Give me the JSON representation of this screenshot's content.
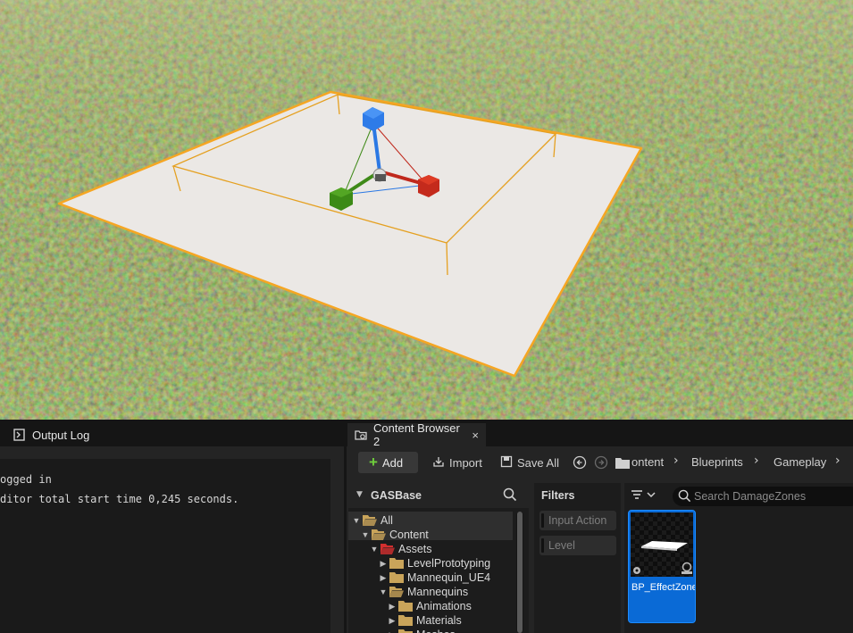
{
  "output_log": {
    "tab_label": "Output Log",
    "lines": [
      "ogged in",
      "ditor total start time 0,245 seconds."
    ]
  },
  "content_browser": {
    "tab_label": "Content Browser 2",
    "close_glyph": "×",
    "toolbar": {
      "add_label": "Add",
      "import_label": "Import",
      "save_all_label": "Save All"
    },
    "breadcrumb": [
      "ontent",
      "Blueprints",
      "Gameplay"
    ],
    "tree": {
      "header": "GASBase",
      "items": [
        {
          "label": "All",
          "arrow": "▼",
          "folder": "open"
        },
        {
          "label": "Content",
          "arrow": "▼",
          "folder": "open"
        },
        {
          "label": "Assets",
          "arrow": "▼",
          "folder": "open-red"
        },
        {
          "label": "LevelPrototyping",
          "arrow": "▶",
          "folder": "closed"
        },
        {
          "label": "Mannequin_UE4",
          "arrow": "▶",
          "folder": "closed"
        },
        {
          "label": "Mannequins",
          "arrow": "▼",
          "folder": "open"
        },
        {
          "label": "Animations",
          "arrow": "▶",
          "folder": "closed"
        },
        {
          "label": "Materials",
          "arrow": "▶",
          "folder": "closed"
        },
        {
          "label": "Meshes",
          "arrow": "▶",
          "folder": "closed"
        }
      ]
    },
    "filters": {
      "header": "Filters",
      "items": [
        "Input Action",
        "Level"
      ]
    },
    "search_placeholder": "Search DamageZones",
    "asset": {
      "name": "BP_EffectZoneActor"
    }
  },
  "colors": {
    "accent_blue": "#0a6ad6",
    "selection_orange": "#f5a623",
    "folder_yellow": "#c9a45a",
    "folder_red": "#d32f2f"
  }
}
